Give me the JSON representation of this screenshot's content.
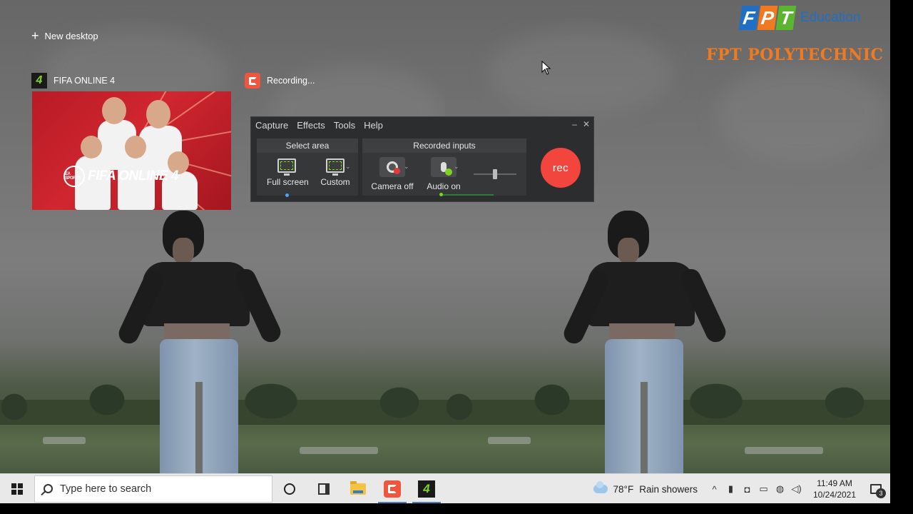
{
  "task_view": {
    "new_desktop_label": "New desktop",
    "windows": [
      {
        "title": "FIFA ONLINE 4",
        "icon": "fifa-online-4-icon"
      },
      {
        "title": "Recording...",
        "icon": "camtasia-icon"
      }
    ],
    "fifa_thumbnail": {
      "logo_text": "FIFA ONLINE 4",
      "ea_badge": "EA SPORTS"
    }
  },
  "recorder": {
    "menu": [
      "Capture",
      "Effects",
      "Tools",
      "Help"
    ],
    "window_buttons": {
      "minimize": "–",
      "close": "✕"
    },
    "select_area": {
      "heading": "Select area",
      "full_screen": "Full screen",
      "custom": "Custom"
    },
    "recorded_inputs": {
      "heading": "Recorded inputs",
      "camera": "Camera off",
      "audio": "Audio on",
      "audio_volume_fraction": 0.5
    },
    "rec_button": "rec",
    "colors": {
      "rec": "#f1453d",
      "accent": "#7ed321"
    }
  },
  "watermark": {
    "fpt_letters": [
      "F",
      "P",
      "T"
    ],
    "fpt_colors": [
      "#1f6fc5",
      "#f07a22",
      "#5cb531"
    ],
    "education": "Education",
    "polytechnic": "FPT POLYTECHNIC"
  },
  "taskbar": {
    "search_placeholder": "Type here to search",
    "apps": [
      {
        "name": "cortana",
        "icon": "cortana-icon"
      },
      {
        "name": "task-view",
        "icon": "task-view-icon"
      },
      {
        "name": "file-explorer",
        "icon": "folder-icon"
      },
      {
        "name": "camtasia",
        "icon": "camtasia-icon",
        "active": true
      },
      {
        "name": "fifa-online-4",
        "icon": "fifa-online-4-icon",
        "active": true
      }
    ],
    "weather": {
      "temp": "78°F",
      "condition": "Rain showers"
    },
    "tray_icons": [
      "chevron-up-icon",
      "microphone-icon",
      "recording-tray-icon",
      "battery-icon",
      "network-icon",
      "speaker-icon"
    ],
    "clock": {
      "time": "11:49 AM",
      "date": "10/24/2021"
    },
    "notifications_count": "3"
  }
}
